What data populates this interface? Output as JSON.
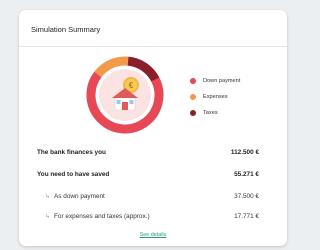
{
  "card": {
    "title": "Simulation Summary"
  },
  "colors": {
    "down_payment": "#e84855",
    "expenses": "#f2994a",
    "taxes": "#8b1e2b",
    "link": "#2a9d7d"
  },
  "legend": [
    {
      "label": "Down payment",
      "color": "#e84855"
    },
    {
      "label": "Expenses",
      "color": "#f2994a"
    },
    {
      "label": "Taxes",
      "color": "#8b1e2b"
    }
  ],
  "chart_data": {
    "type": "pie",
    "categories": [
      "Down payment",
      "Expenses",
      "Taxes"
    ],
    "values": [
      37500,
      8885.5,
      8885.5
    ]
  },
  "summary": {
    "bank_finances_label": "The bank finances you",
    "bank_finances_value": "112.500 €",
    "need_saved_label": "You need to have saved",
    "need_saved_value": "55.271 €",
    "down_payment_label": "As down payment",
    "down_payment_value": "37.500 €",
    "expenses_taxes_label": "For expenses and taxes (approx.)",
    "expenses_taxes_value": "17.771 €"
  },
  "details_link": "See details"
}
